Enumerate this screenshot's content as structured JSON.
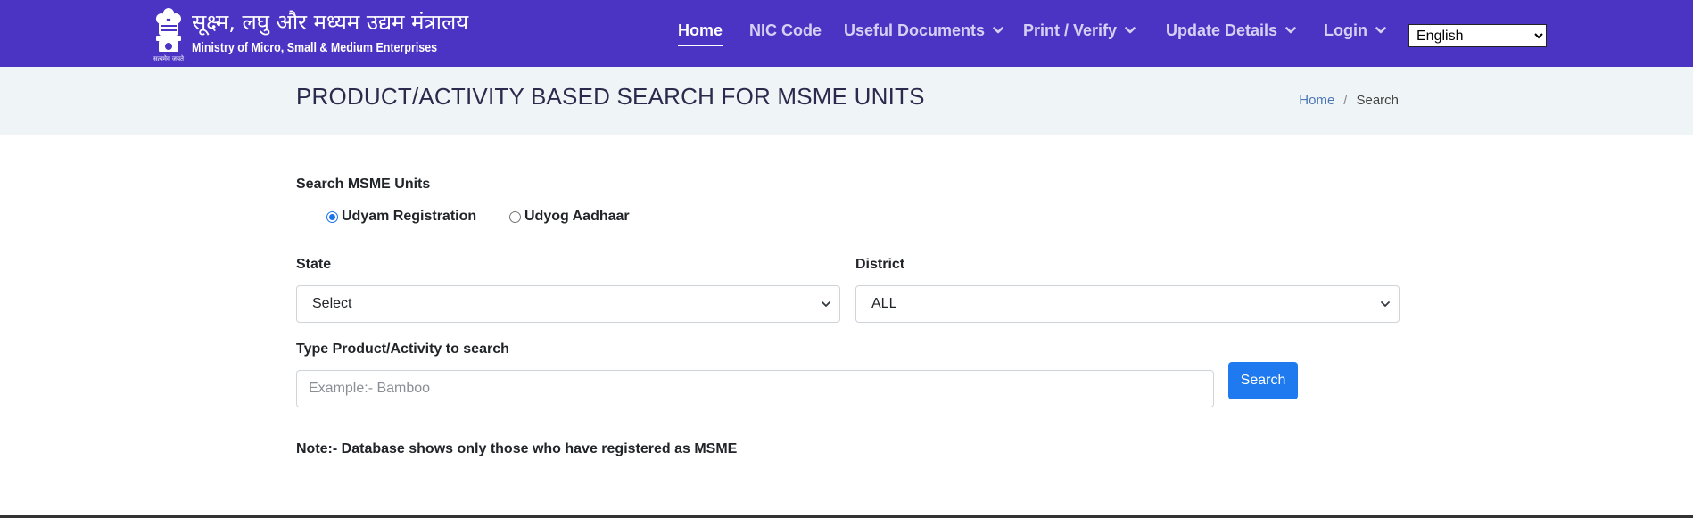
{
  "header": {
    "brand_hindi": "सूक्ष्म, लघु और मध्यम उद्यम मंत्रालय",
    "brand_english": "Ministry of Micro, Small & Medium Enterprises",
    "emblem_caption": "सत्यमेव जयते",
    "nav": {
      "home": "Home",
      "nic_code": "NIC Code",
      "useful_documents": "Useful Documents",
      "print_verify": "Print / Verify",
      "update_details": "Update Details",
      "login": "Login"
    },
    "language": {
      "selected": "English"
    },
    "colors": {
      "bar": "#4b34c4",
      "active_text": "#ffffff",
      "inactive_text": "#d5d0f2"
    }
  },
  "title_band": {
    "title": "PRODUCT/ACTIVITY BASED SEARCH FOR MSME UNITS",
    "breadcrumb": {
      "home": "Home",
      "separator": "/",
      "current": "Search"
    }
  },
  "form": {
    "search_units_label": "Search MSME Units",
    "radio_udyam": {
      "label": "Udyam Registration",
      "checked": true
    },
    "radio_udyog": {
      "label": "Udyog Aadhaar",
      "checked": false
    },
    "state": {
      "label": "State",
      "value": "Select"
    },
    "district": {
      "label": "District",
      "value": "ALL"
    },
    "product": {
      "label": "Type Product/Activity to search",
      "value": "",
      "placeholder": "Example:- Bamboo"
    },
    "search_button": "Search",
    "note": "Note:- Database shows only those who have registered as MSME",
    "colors": {
      "button": "#1f7af0",
      "radio_accent": "#1a73e8"
    }
  },
  "icons": {
    "emblem": "national-emblem-icon",
    "caret": "chevron-down-icon"
  }
}
